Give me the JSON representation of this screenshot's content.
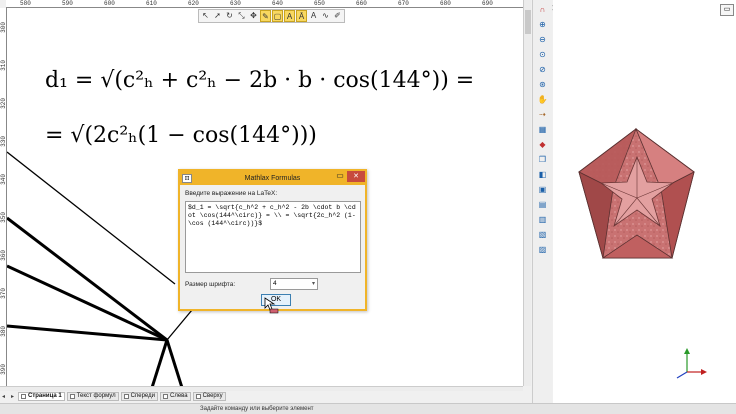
{
  "ruler": {
    "top_ticks": [
      "580",
      "590",
      "600",
      "610",
      "620",
      "630",
      "640",
      "650",
      "660",
      "670",
      "680",
      "690"
    ],
    "left_ticks": [
      "300",
      "310",
      "320",
      "330",
      "340",
      "350",
      "360",
      "370",
      "380",
      "390"
    ]
  },
  "canvas": {
    "formula_line1": "d₁ = √(c²ₕ + c²ₕ − 2b · b · cos(144°)) =",
    "formula_line2": "= √(2c²ₕ(1 − cos(144°)))"
  },
  "floating_toolbar": {
    "icons": [
      "arrow-icon",
      "cursor-icon",
      "rotate-icon",
      "scale-icon",
      "move-icon",
      "pen-icon",
      "frame-icon",
      "text-icon",
      "text-frame-icon",
      "text-bold-icon",
      "curve-icon",
      "brush-icon"
    ]
  },
  "tabs": [
    {
      "label": "Страница 1",
      "active": true
    },
    {
      "label": "Текст формул",
      "active": false
    },
    {
      "label": "Спереди",
      "active": false
    },
    {
      "label": "Слева",
      "active": false
    },
    {
      "label": "Сверху",
      "active": false
    }
  ],
  "status": {
    "message": "Задайте команду или выберите элемент"
  },
  "right_toolbar": {
    "icons": [
      "magnet-icon",
      "zoom-in-icon",
      "zoom-out-icon",
      "zoom-fit-icon",
      "zoom-window-icon",
      "zoom-all-icon",
      "pan-icon",
      "step-icon",
      "view-icon",
      "shading-icon",
      "cube-icon",
      "edge-icon",
      "box-icon",
      "layer-icon",
      "stack-icon",
      "stack2-icon",
      "stack3-icon"
    ]
  },
  "dialog": {
    "title": "Mathlax Formulas",
    "prompt": "Введите выражение на LaTeX:",
    "latex_value": "$d_1 = \\sqrt{c_h^2 + c_h^2 - 2b \\cdot b \\cdot \\cos(144^\\circ)} = \\\\ = \\sqrt{2c_h^2 (1-\\cos (144^\\circ))}$",
    "font_size_label": "Размер шрифта:",
    "font_size_value": "4",
    "ok_label": "OK",
    "close_label": "✕",
    "minimize_label": "▭",
    "icon_label": "π"
  },
  "colors": {
    "dialog_border": "#f0b429",
    "close_button": "#c74a3d",
    "solid_face": "#c96a6a"
  }
}
